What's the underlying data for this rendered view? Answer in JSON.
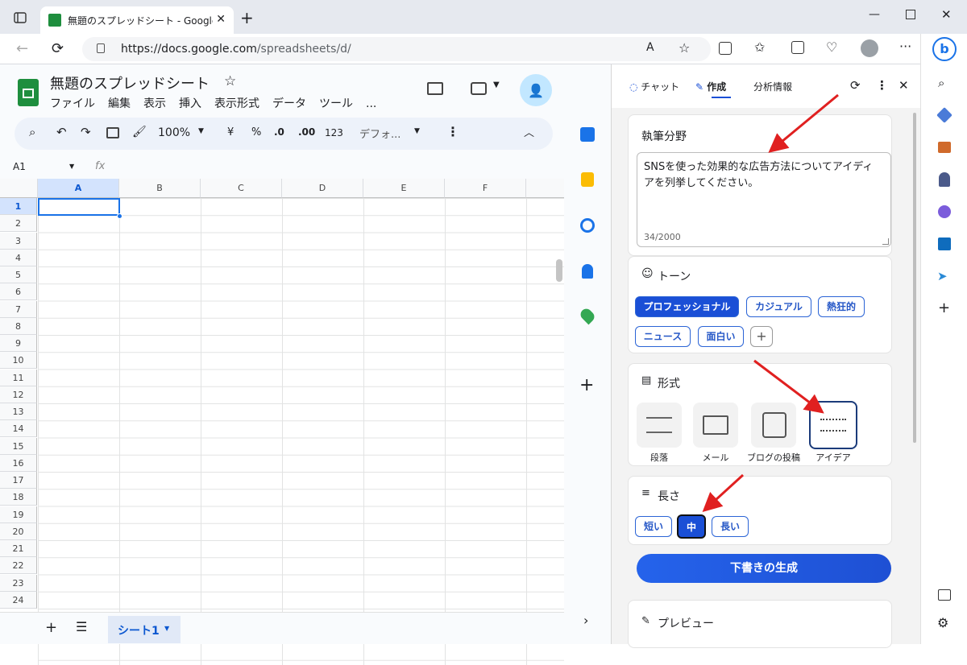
{
  "browser": {
    "tab_title": "無題のスプレッドシート - Google スプ",
    "url_host": "https://docs.google.com",
    "url_path": "/spreadsheets/d/"
  },
  "sheets": {
    "doc_title": "無題のスプレッドシート",
    "menus": [
      "ファイル",
      "編集",
      "表示",
      "挿入",
      "表示形式",
      "データ",
      "ツール",
      "..."
    ],
    "toolbar": {
      "zoom": "100%",
      "currency": "¥",
      "percent": "%",
      "dec_less": ".0",
      "dec_more": ".00",
      "number_format": "123",
      "font": "デフォ..."
    },
    "name_box": "A1",
    "fx": "fx",
    "columns": [
      "A",
      "B",
      "C",
      "D",
      "E",
      "F"
    ],
    "rows": [
      "1",
      "2",
      "3",
      "4",
      "5",
      "6",
      "7",
      "8",
      "9",
      "10",
      "11",
      "12",
      "13",
      "14",
      "15",
      "16",
      "17",
      "18",
      "19",
      "20",
      "21",
      "22",
      "23",
      "24"
    ],
    "sheet_tab": "シート1"
  },
  "copilot": {
    "tabs": [
      "チャット",
      "作成",
      "分析情報"
    ],
    "active_tab": "作成",
    "topic_label": "執筆分野",
    "topic_text": "SNSを使った効果的な広告方法についてアイディアを列挙してください。",
    "char_count": "34/2000",
    "tone_label": "トーン",
    "tones": [
      "プロフェッショナル",
      "カジュアル",
      "熱狂的",
      "ニュース",
      "面白い"
    ],
    "selected_tone": "プロフェッショナル",
    "format_label": "形式",
    "formats": [
      "段落",
      "メール",
      "ブログの投稿",
      "アイデア"
    ],
    "selected_format": "アイデア",
    "length_label": "長さ",
    "lengths": [
      "短い",
      "中",
      "長い"
    ],
    "selected_length": "中",
    "generate_label": "下書きの生成",
    "preview_label": "プレビュー"
  },
  "colors": {
    "accent": "#1a4fd6",
    "sheets_green": "#1e8e3e",
    "arrow": "#e02020"
  }
}
